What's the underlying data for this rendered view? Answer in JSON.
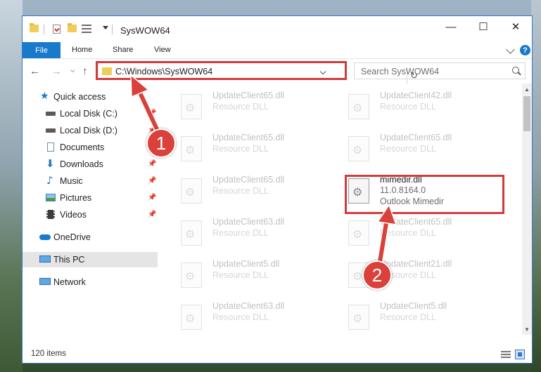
{
  "window": {
    "title": "SysWOW64",
    "minimize_glyph": "—",
    "maximize_glyph": "☐",
    "close_glyph": "✕"
  },
  "ribbon": {
    "tabs": [
      "File",
      "Home",
      "Share",
      "View"
    ],
    "help_glyph": "?"
  },
  "nav": {
    "back_glyph": "←",
    "forward_glyph": "→",
    "recent_glyph": "⌄",
    "up_glyph": "↑",
    "address": "C:\\Windows\\SysWOW64",
    "refresh_glyph": "↻",
    "search_placeholder": "Search SysWOW64"
  },
  "sidebar": {
    "items": [
      {
        "label": "Quick access",
        "icon": "star-icon",
        "pinned": false
      },
      {
        "label": "Local Disk (C:)",
        "icon": "drive-icon",
        "pinned": true
      },
      {
        "label": "Local Disk (D:)",
        "icon": "drive-icon",
        "pinned": true
      },
      {
        "label": "Documents",
        "icon": "documents-icon",
        "pinned": true
      },
      {
        "label": "Downloads",
        "icon": "download-icon",
        "pinned": true
      },
      {
        "label": "Music",
        "icon": "music-icon",
        "pinned": true
      },
      {
        "label": "Pictures",
        "icon": "pictures-icon",
        "pinned": true
      },
      {
        "label": "Videos",
        "icon": "videos-icon",
        "pinned": true
      },
      {
        "label": "OneDrive",
        "icon": "cloud-icon",
        "pinned": false
      },
      {
        "label": "This PC",
        "icon": "computer-icon",
        "pinned": false,
        "selected": true
      },
      {
        "label": "Network",
        "icon": "network-icon",
        "pinned": false
      }
    ],
    "pin_glyph": "📌"
  },
  "files": [
    {
      "name": "UpdateClient65.dll",
      "type": "Resource DLL"
    },
    {
      "name": "UpdateClient42.dll",
      "type": "Resource DLL"
    },
    {
      "name": "UpdateClient65.dll",
      "type": "Resource DLL"
    },
    {
      "name": "UpdateClient65.dll",
      "type": "Resource DLL"
    },
    {
      "name": "UpdateClient65.dll",
      "type": "Resource DLL"
    },
    {
      "name": "mimedir.dll",
      "version": "11.0.8164.0",
      "type": "Outlook Mimedir",
      "highlighted": true
    },
    {
      "name": "UpdateClient63.dll",
      "type": "Resource DLL"
    },
    {
      "name": "UpdateClient65.dll",
      "type": "Resource DLL"
    },
    {
      "name": "UpdateClient5.dll",
      "type": "Resource DLL"
    },
    {
      "name": "UpdateClient21.dll",
      "type": "Resource DLL"
    },
    {
      "name": "UpdateClient63.dll",
      "type": "Resource DLL"
    },
    {
      "name": "UpdateClient5.dll",
      "type": "Resource DLL"
    }
  ],
  "status": {
    "item_count": "120 items"
  },
  "annotations": {
    "step1": "1",
    "step2": "2",
    "color": "#d9413a"
  }
}
